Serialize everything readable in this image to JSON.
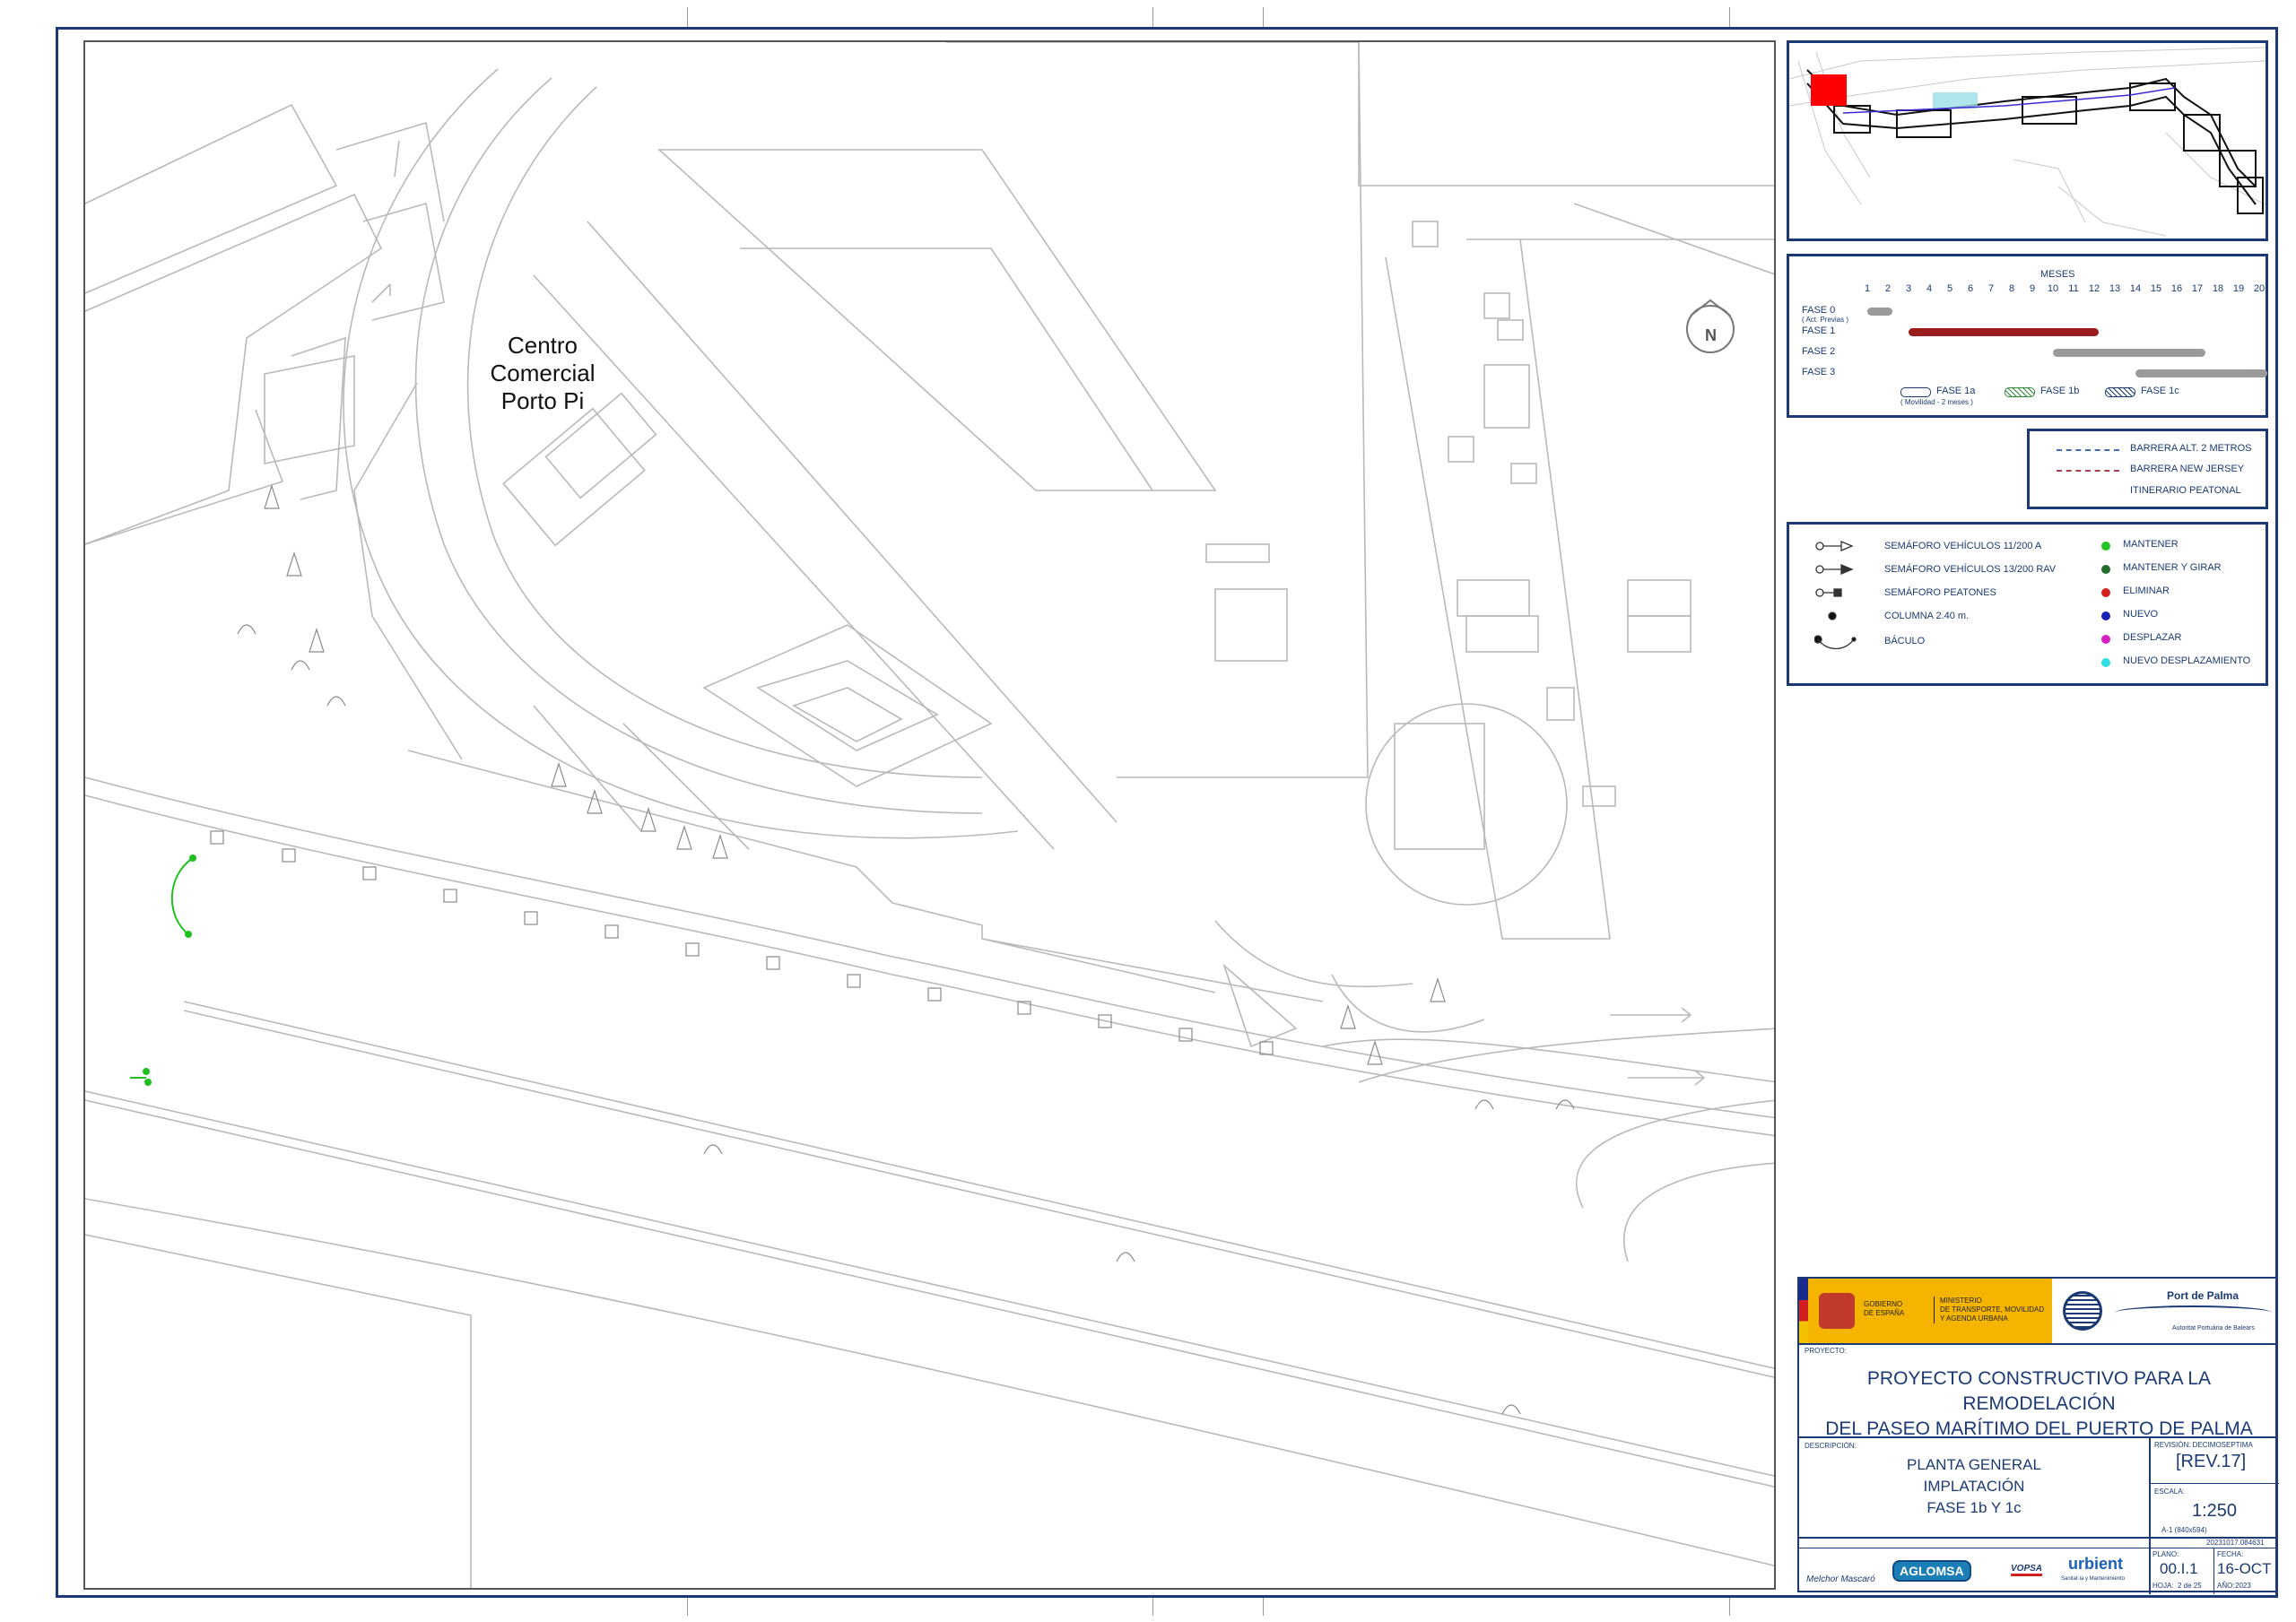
{
  "map": {
    "label_line1": "Centro",
    "label_line2": "Comercial",
    "label_line3": "Porto Pi",
    "north_letter": "N"
  },
  "gantt": {
    "months_header": "MESES",
    "months": [
      "1",
      "2",
      "3",
      "4",
      "5",
      "6",
      "7",
      "8",
      "9",
      "10",
      "11",
      "12",
      "13",
      "14",
      "15",
      "16",
      "17",
      "18",
      "19",
      "20"
    ],
    "phases": [
      {
        "label": "FASE 0",
        "sub": "( Act. Previas )",
        "start": 1,
        "end": 2.2,
        "color": "#9a9a9a"
      },
      {
        "label": "FASE 1",
        "sub": "",
        "start": 3,
        "end": 12.2,
        "color": "#9b1c1c"
      },
      {
        "label": "FASE 2",
        "sub": "",
        "start": 10,
        "end": 17.4,
        "color": "#9a9a9a"
      },
      {
        "label": "FASE 3",
        "sub": "",
        "start": 14,
        "end": 20.4,
        "color": "#9a9a9a"
      }
    ],
    "sub_phases": [
      {
        "label": "FASE 1a",
        "note": "( Movilidad - 2 meses )"
      },
      {
        "label": "FASE 1b",
        "note": ""
      },
      {
        "label": "FASE 1c",
        "note": ""
      }
    ]
  },
  "barriers": {
    "items": [
      {
        "label": "BARRERA ALT. 2 METROS",
        "color": "#3f6fb0"
      },
      {
        "label": "BARRERA NEW JERSEY",
        "color": "#b03f4a"
      },
      {
        "label": "ITINERARIO  PEATONAL",
        "color": ""
      }
    ]
  },
  "legend": {
    "left": [
      "SEMÁFORO VEHÍCULOS 11/200 A",
      "SEMÁFORO VEHÍCULOS 13/200 RAV",
      "SEMÁFORO PEATONES",
      "COLUMNA 2.40 m.",
      "BÁCULO"
    ],
    "right": [
      {
        "label": "MANTENER",
        "color": "#22c322"
      },
      {
        "label": "MANTENER Y GIRAR",
        "color": "#1f6e2e"
      },
      {
        "label": "ELIMINAR",
        "color": "#d61f1f"
      },
      {
        "label": "NUEVO",
        "color": "#1a22b3"
      },
      {
        "label": "DESPLAZAR",
        "color": "#d61fc4"
      },
      {
        "label": "NUEVO DESPLAZAMIENTO",
        "color": "#2fe0e6"
      }
    ]
  },
  "titleblock": {
    "gov_line1": "GOBIERNO",
    "gov_line2": "DE ESPAÑA",
    "ministry_line1": "MINISTERIO",
    "ministry_line2": "DE TRANSPORTE, MOVILIDAD",
    "ministry_line3": "Y AGENDA URBANA",
    "port_name": "Port de Palma",
    "port_authority": "Autoritat Portuària de Balears",
    "project_caption": "PROYECTO:",
    "project_line1": "PROYECTO CONSTRUCTIVO PARA LA REMODELACIÓN",
    "project_line2": "DEL PASEO MARÍTIMO DEL PUERTO DE PALMA",
    "desc_caption": "DESCRIPCIÓN:",
    "desc_line1": "PLANTA GENERAL",
    "desc_line2": "IMPLATACIÓN",
    "desc_line3": "FASE 1b Y 1c",
    "revision_caption": "REVISIÓN: DECIMOSEPTIMA",
    "revision": "[REV.17]",
    "scale_caption": "ESCALA:",
    "scale": "1:250",
    "paper_note": "A-1 (840x594)",
    "file_code": "20231017.084631",
    "company1": "Melchor Mascaró",
    "company2": "AGLOMSA",
    "company3": "VOPSA",
    "company4": "urbient",
    "company4_sub": "Sanitat·ia y Mantenimiento",
    "plan_caption": "PLANO:",
    "plan": "00.I.1",
    "sheet_caption": "HOJA:",
    "sheet": "2 de 25",
    "date_caption": "FECHA:",
    "date": "16-OCT",
    "year_caption": "AÑO:",
    "year": "2023"
  }
}
